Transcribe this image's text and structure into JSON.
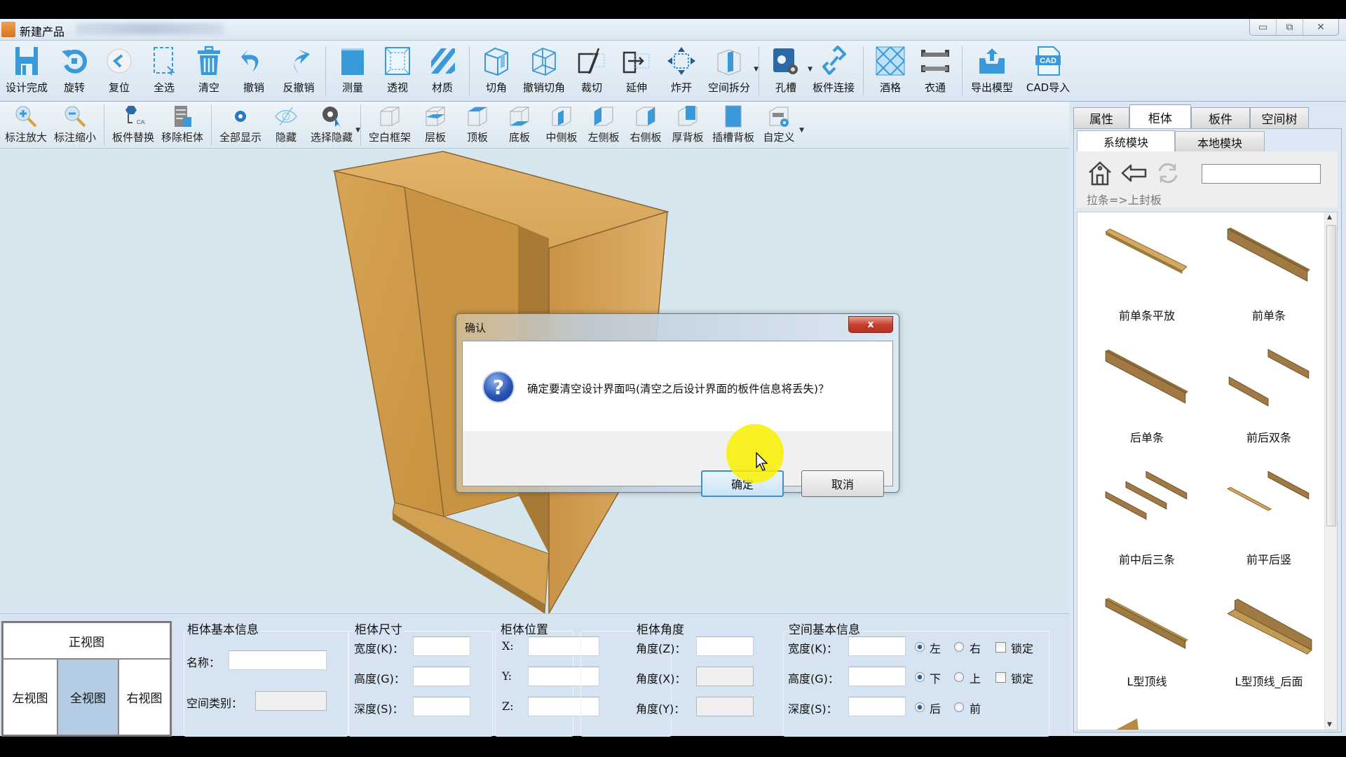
{
  "window": {
    "title": "新建产品",
    "controls": [
      "minimize",
      "restore",
      "close"
    ]
  },
  "toolbar_main": [
    {
      "id": "design-done",
      "label": "设计完成",
      "icon": "save-icon"
    },
    {
      "id": "rotate",
      "label": "旋转",
      "icon": "rotate-icon"
    },
    {
      "id": "reset",
      "label": "复位",
      "icon": "reset-icon"
    },
    {
      "id": "select-all",
      "label": "全选",
      "icon": "select-all-icon"
    },
    {
      "id": "clear",
      "label": "清空",
      "icon": "trash-icon"
    },
    {
      "id": "undo",
      "label": "撤销",
      "icon": "undo-icon"
    },
    {
      "id": "redo",
      "label": "反撤销",
      "icon": "redo-icon"
    },
    {
      "sep": true
    },
    {
      "id": "measure",
      "label": "测量",
      "icon": "measure-icon"
    },
    {
      "id": "perspective",
      "label": "透视",
      "icon": "perspective-icon"
    },
    {
      "id": "material",
      "label": "材质",
      "icon": "material-icon"
    },
    {
      "sep": true
    },
    {
      "id": "chamfer",
      "label": "切角",
      "icon": "chamfer-icon"
    },
    {
      "id": "undo-chamfer",
      "label": "撤销切角",
      "icon": "undo-chamfer-icon"
    },
    {
      "id": "cut",
      "label": "裁切",
      "icon": "cut-icon"
    },
    {
      "id": "extend",
      "label": "延伸",
      "icon": "extend-icon"
    },
    {
      "id": "explode",
      "label": "炸开",
      "icon": "explode-icon"
    },
    {
      "id": "space-split",
      "label": "空间拆分",
      "icon": "space-split-icon",
      "dropdown": true
    },
    {
      "sep": true
    },
    {
      "id": "hole-slot",
      "label": "孔槽",
      "icon": "hole-slot-icon",
      "dropdown": true
    },
    {
      "id": "board-connect",
      "label": "板件连接",
      "icon": "link-icon"
    },
    {
      "sep": true
    },
    {
      "id": "wine-rack",
      "label": "酒格",
      "icon": "wine-rack-icon"
    },
    {
      "id": "clothes-rail",
      "label": "衣通",
      "icon": "clothes-rail-icon"
    },
    {
      "sep": true
    },
    {
      "id": "export-model",
      "label": "导出模型",
      "icon": "export-icon"
    },
    {
      "id": "cad-import",
      "label": "CAD导入",
      "icon": "cad-file-icon"
    }
  ],
  "toolbar_secondary": [
    {
      "id": "zoom-in-label",
      "label": "标注放大",
      "icon": "zoom-in-icon"
    },
    {
      "id": "zoom-out-label",
      "label": "标注缩小",
      "icon": "zoom-out-icon"
    },
    {
      "sep": true
    },
    {
      "id": "replace-board",
      "label": "板件替换",
      "icon": "cad-replace-icon"
    },
    {
      "id": "remove-cabinet",
      "label": "移除柜体",
      "icon": "remove-cabinet-icon"
    },
    {
      "sep": true
    },
    {
      "id": "show-all",
      "label": "全部显示",
      "icon": "eye-icon"
    },
    {
      "id": "hide",
      "label": "隐藏",
      "icon": "eye-off-icon"
    },
    {
      "id": "select-hide",
      "label": "选择隐藏",
      "icon": "eye-select-icon",
      "dropdown": true
    },
    {
      "sep": true
    },
    {
      "id": "empty-frame",
      "label": "空白框架",
      "icon": "frame-empty-icon"
    },
    {
      "id": "shelf",
      "label": "层板",
      "icon": "frame-shelf-icon"
    },
    {
      "id": "top-board",
      "label": "顶板",
      "icon": "frame-top-icon"
    },
    {
      "id": "bottom-board",
      "label": "底板",
      "icon": "frame-bottom-icon"
    },
    {
      "id": "middle-side",
      "label": "中侧板",
      "icon": "frame-middle-icon"
    },
    {
      "id": "left-side",
      "label": "左侧板",
      "icon": "frame-left-icon"
    },
    {
      "id": "right-side",
      "label": "右侧板",
      "icon": "frame-right-icon"
    },
    {
      "id": "thick-back",
      "label": "厚背板",
      "icon": "frame-back-icon"
    },
    {
      "id": "slot-back",
      "label": "插槽背板",
      "icon": "slot-back-icon"
    },
    {
      "id": "custom",
      "label": "自定义",
      "icon": "custom-gear-icon",
      "dropdown": true
    }
  ],
  "right_panel": {
    "tabs": [
      "属性",
      "柜体",
      "板件",
      "空间树"
    ],
    "active_tab": "柜体",
    "subtabs": [
      "系统模块",
      "本地模块"
    ],
    "active_subtab": "系统模块",
    "breadcrumb": "拉条=>上封板",
    "search_value": "",
    "items": [
      {
        "name": "前单条平放",
        "shape": "flat"
      },
      {
        "name": "前单条",
        "shape": "tall"
      },
      {
        "name": "后单条",
        "shape": "tall"
      },
      {
        "name": "前后双条",
        "shape": "double"
      },
      {
        "name": "前中后三条",
        "shape": "triple"
      },
      {
        "name": "前平后竖",
        "shape": "flat-tall"
      },
      {
        "name": "L型顶线",
        "shape": "l"
      },
      {
        "name": "L型顶线_后面",
        "shape": "l-back"
      }
    ]
  },
  "bottom_panel": {
    "views": {
      "front": "正视图",
      "left": "左视图",
      "all": "全视图",
      "right": "右视图",
      "active": "全视图"
    },
    "basic_info": {
      "title": "柜体基本信息",
      "name_label": "名称：",
      "name_value": "",
      "space_type_label": "空间类别：",
      "space_type_value": ""
    },
    "size": {
      "title": "柜体尺寸",
      "width_label": "宽度(K)：",
      "height_label": "高度(G)：",
      "depth_label": "深度(S)：",
      "width": "",
      "height": "",
      "depth": ""
    },
    "position": {
      "title": "柜体位置",
      "x_label": "X:",
      "y_label": "Y:",
      "z_label": "Z:",
      "x": "",
      "y": "",
      "z": ""
    },
    "angle": {
      "title": "柜体角度",
      "z_label": "角度(Z)：",
      "x_label": "角度(X)：",
      "y_label": "角度(Y)：",
      "z": "",
      "x": "",
      "y": ""
    },
    "space_info": {
      "title": "空间基本信息",
      "width_label": "宽度(K)：",
      "height_label": "高度(G)：",
      "depth_label": "深度(S)：",
      "width": "",
      "height": "",
      "depth": "",
      "width_options": [
        "左",
        "右"
      ],
      "width_selected": "左",
      "width_lock_label": "锁定",
      "width_locked": false,
      "height_options": [
        "下",
        "上"
      ],
      "height_selected": "下",
      "height_lock_label": "锁定",
      "height_locked": false,
      "depth_options": [
        "后",
        "前"
      ],
      "depth_selected": "后"
    }
  },
  "dialog": {
    "title": "确认",
    "message": "确定要清空设计界面吗(清空之后设计界面的板件信息将丢失)？",
    "ok_label": "确定",
    "cancel_label": "取消",
    "close_label": "x",
    "icon": "question-icon"
  },
  "colors": {
    "accent_blue": "#3a9ad9",
    "wood": "#d9a85a",
    "viewport_bg": "#d6e6ee",
    "panel_bg": "#d6e3f0",
    "highlight": "#faf000"
  }
}
